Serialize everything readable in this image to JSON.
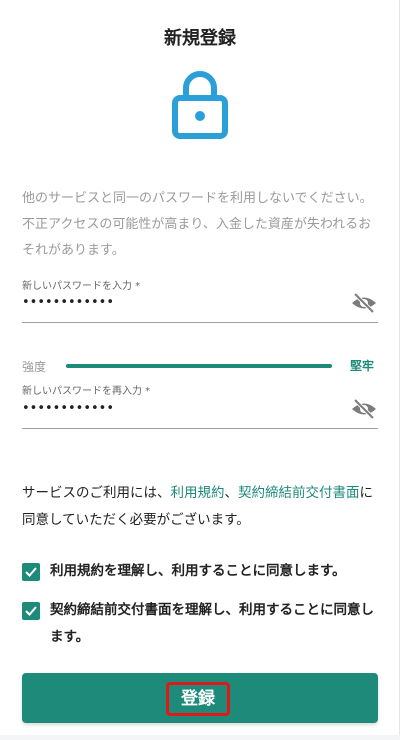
{
  "page": {
    "title": "新規登録",
    "warning": "他のサービスと同一のパスワードを利用しないでください。不正アクセスの可能性が高まり、入金した資産が失われるおそれがあります。"
  },
  "password": {
    "label": "新しいパスワードを入力 *",
    "value": "••••••••••••"
  },
  "strength": {
    "label": "強度",
    "value": "堅牢",
    "level": 1.0
  },
  "confirm": {
    "label": "新しいパスワードを再入力 *",
    "value": "••••••••••••"
  },
  "consent": {
    "prefix": "サービスのご利用には、",
    "link_terms": "利用規約",
    "separator": "、",
    "link_contract": "契約締結前交付書面",
    "suffix": "に同意していただく必要がございます。"
  },
  "checks": [
    {
      "label": "利用規約を理解し、利用することに同意します。",
      "checked": true
    },
    {
      "label": "契約締結前交付書面を理解し、利用することに同意します。",
      "checked": true
    }
  ],
  "submit": {
    "label": "登録"
  },
  "colors": {
    "accent": "#1d8a7a",
    "icon": "#2a9fd8",
    "highlight": "#e01818"
  },
  "icons": {
    "lock": "lock-icon",
    "eye_off": "eye-off-icon",
    "check": "check-icon"
  }
}
